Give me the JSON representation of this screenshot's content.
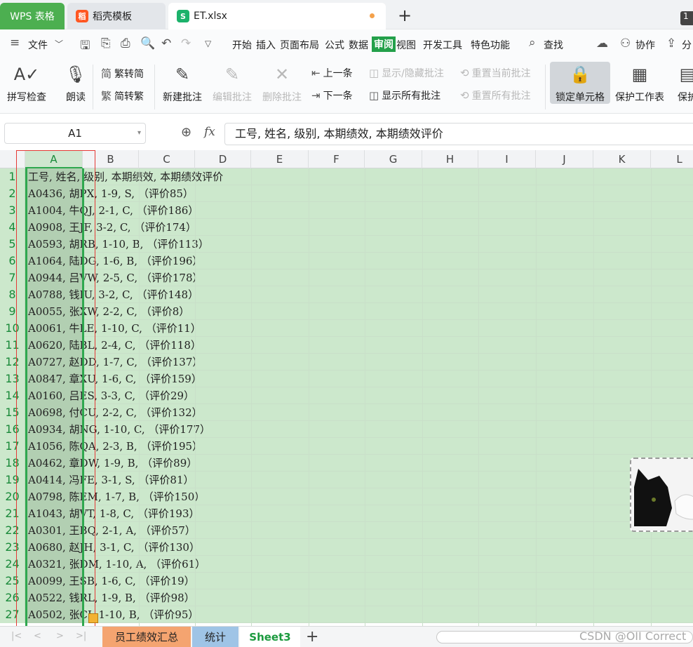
{
  "tabs": {
    "wps": "WPS 表格",
    "daoke": "稻壳模板",
    "daoke_logo": "稻",
    "et": "ET.xlsx",
    "et_logo": "S",
    "count": "1"
  },
  "menu": {
    "file": "文件",
    "items": [
      "开始",
      "插入",
      "页面布局",
      "公式",
      "数据",
      "审阅",
      "视图",
      "开发工具",
      "特色功能"
    ],
    "search": "查找",
    "collab": "协作",
    "share": "分"
  },
  "ribbon": {
    "spellcheck": "拼写检查",
    "read_aloud": "朗读",
    "trad_to_simp": "繁转简",
    "simp_to_trad": "简转繁",
    "new_comment": "新建批注",
    "edit_comment": "编辑批注",
    "delete_comment": "删除批注",
    "prev": "上一条",
    "next": "下一条",
    "show_hide": "显示/隐藏批注",
    "show_all": "显示所有批注",
    "reset_current": "重置当前批注",
    "reset_all": "重置所有批注",
    "lock_cell": "锁定单元格",
    "protect_sheet": "保护工作表",
    "protect_more": "保护"
  },
  "formula": {
    "cell_ref": "A1",
    "content": "工号, 姓名, 级别, 本期绩效, 本期绩效评价"
  },
  "columns": [
    "A",
    "B",
    "C",
    "D",
    "E",
    "F",
    "G",
    "H",
    "I",
    "J",
    "K",
    "L"
  ],
  "rows": [
    {
      "n": "1",
      "text": "工号, 姓名, 级别, 本期绩效, 本期绩效评价"
    },
    {
      "n": "2",
      "text": "A0436, 胡PX, 1-9, S, （评价85）"
    },
    {
      "n": "3",
      "text": "A1004, 牛QJ, 2-1, C, （评价186）"
    },
    {
      "n": "4",
      "text": "A0908, 王JF, 3-2, C, （评价174）"
    },
    {
      "n": "5",
      "text": "A0593, 胡RB, 1-10, B, （评价113）"
    },
    {
      "n": "6",
      "text": "A1064, 陆DG, 1-6, B, （评价196）"
    },
    {
      "n": "7",
      "text": "A0944, 吕VW, 2-5, C, （评价178）"
    },
    {
      "n": "8",
      "text": "A0788, 钱IU, 3-2, C, （评价148）"
    },
    {
      "n": "9",
      "text": "A0055, 张XW, 2-2, C, （评价8）"
    },
    {
      "n": "10",
      "text": "A0061, 牛LE, 1-10, C, （评价11）"
    },
    {
      "n": "11",
      "text": "A0620, 陆BL, 2-4, C, （评价118）"
    },
    {
      "n": "12",
      "text": "A0727, 赵DD, 1-7, C, （评价137）"
    },
    {
      "n": "13",
      "text": "A0847, 章XU, 1-6, C, （评价159）"
    },
    {
      "n": "14",
      "text": "A0160, 吕ES, 3-3, C, （评价29）"
    },
    {
      "n": "15",
      "text": "A0698, 付CU, 2-2, C, （评价132）"
    },
    {
      "n": "16",
      "text": "A0934, 胡NG, 1-10, C, （评价177）"
    },
    {
      "n": "17",
      "text": "A1056, 陈QA, 2-3, B, （评价195）"
    },
    {
      "n": "18",
      "text": "A0462, 章DW, 1-9, B, （评价89）"
    },
    {
      "n": "19",
      "text": "A0414, 冯FE, 3-1, S, （评价81）"
    },
    {
      "n": "20",
      "text": "A0798, 陈EM, 1-7, B, （评价150）"
    },
    {
      "n": "21",
      "text": "A1043, 胡VT, 1-8, C, （评价193）"
    },
    {
      "n": "22",
      "text": "A0301, 王BQ, 2-1, A, （评价57）"
    },
    {
      "n": "23",
      "text": "A0680, 赵JH, 3-1, C, （评价130）"
    },
    {
      "n": "24",
      "text": "A0321, 张DM, 1-10, A, （评价61）"
    },
    {
      "n": "25",
      "text": "A0099, 王SB, 1-6, C, （评价19）"
    },
    {
      "n": "26",
      "text": "A0522, 钱RL, 1-9, B, （评价98）"
    },
    {
      "n": "27",
      "text": "A0502, 张CI, 1-10, B, （评价95）"
    }
  ],
  "sheets": [
    "员工绩效汇总",
    "统计",
    "Sheet3"
  ],
  "watermark": "CSDN @OII Correct",
  "colors": {
    "accent": "#23a04a",
    "grid_fill": "#cce8cc",
    "selected_col": "#b2cfb2",
    "sheet1": "#f4a470",
    "sheet2": "#9fc4e6"
  }
}
